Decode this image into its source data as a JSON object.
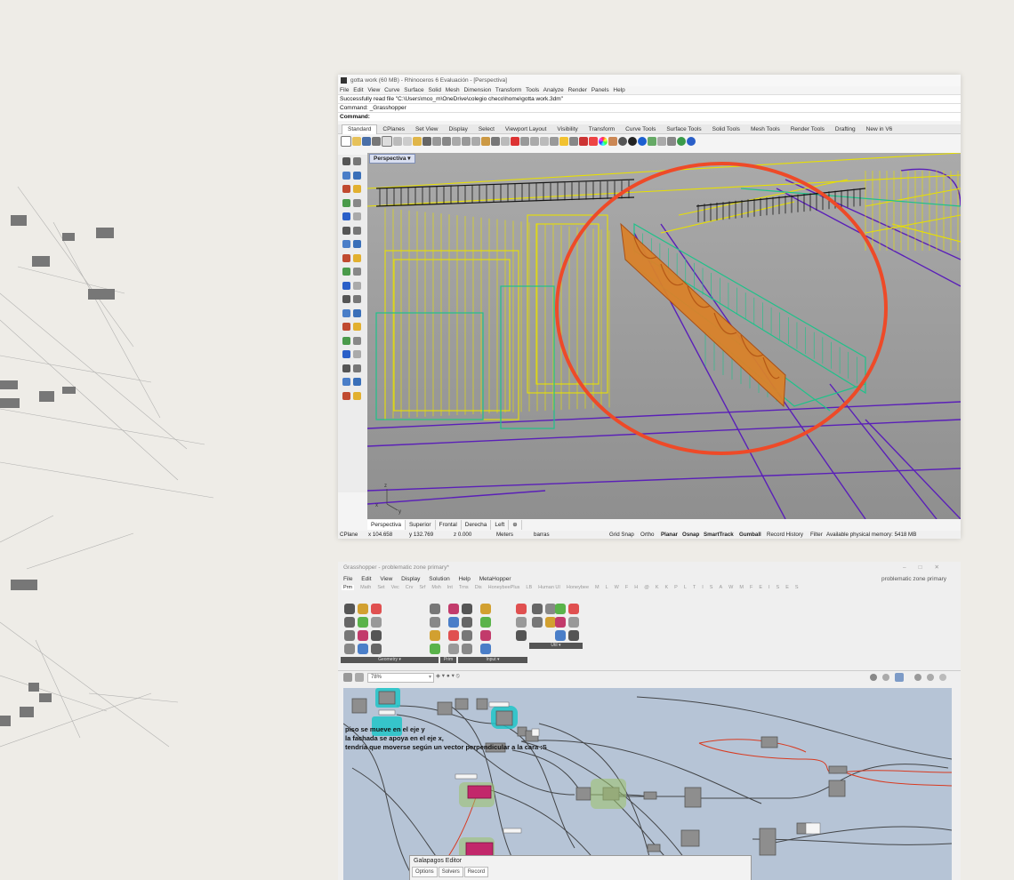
{
  "rhino": {
    "title": "gotta work (60 MB) - Rhinoceros 6 Evaluación - [Perspectiva]",
    "menu": [
      "File",
      "Edit",
      "View",
      "Curve",
      "Surface",
      "Solid",
      "Mesh",
      "Dimension",
      "Transform",
      "Tools",
      "Analyze",
      "Render",
      "Panels",
      "Help"
    ],
    "command_history_line": "Successfully read file \"C:\\Users\\mco_m\\OneDrive\\colegio checo\\home\\gotta work.3dm\"",
    "command_last": "Command: _Grasshopper",
    "command_prompt": "Command:",
    "toolbar_tabs": [
      "Standard",
      "CPlanes",
      "Set View",
      "Display",
      "Select",
      "Viewport Layout",
      "Visibility",
      "Transform",
      "Curve Tools",
      "Surface Tools",
      "Solid Tools",
      "Mesh Tools",
      "Render Tools",
      "Drafting",
      "New in V6"
    ],
    "active_tab": "Standard",
    "viewport_label": "Perspectiva",
    "viewport_tabs": [
      "Perspectiva",
      "Superior",
      "Frontal",
      "Derecha",
      "Left"
    ],
    "status": {
      "cplane": "CPlane",
      "x": "x 104.658",
      "y": "y 132.769",
      "z": "z 0.000",
      "units": "Meters",
      "layer": "barras",
      "toggles": [
        "Grid Snap",
        "Ortho",
        "Planar",
        "Osnap",
        "SmartTrack",
        "Gumball",
        "Record History",
        "Filter"
      ],
      "bold_toggles": [
        "Planar",
        "Osnap",
        "SmartTrack",
        "Gumball"
      ],
      "memory": "Available physical memory: 5418 MB"
    }
  },
  "grasshopper": {
    "title": "Grasshopper - problematic zone primary*",
    "document_name": "problematic zone primary",
    "menu": [
      "File",
      "Edit",
      "View",
      "Display",
      "Solution",
      "Help",
      "MetaHopper"
    ],
    "component_tabs": [
      "Prm",
      "Math",
      "Set",
      "Vec",
      "Crv",
      "Srf",
      "Msh",
      "Int",
      "Trns",
      "Dis",
      "HoneybeePlus",
      "LB",
      "Human UI",
      "Honeybee",
      "M",
      "L",
      "W",
      "F",
      "H",
      "@",
      "K",
      "K",
      "P",
      "L",
      "T",
      "I",
      "S",
      "A",
      "W",
      "M",
      "F",
      "E",
      "I",
      "S",
      "E",
      "S"
    ],
    "active_component_tab": "Prm",
    "ribbon_groups": [
      "Geometry",
      "Prim",
      "Input",
      "Util"
    ],
    "zoom": "78%",
    "canvas_note_lines": [
      "piso se mueve en el eje y",
      "la fachada se apoya en el eje x,",
      "tendría que moverse según un vector perpendicular a la cara :S"
    ]
  },
  "galapagos": {
    "title": "Galapagos Editor",
    "tabs": [
      "Options",
      "Solvers",
      "Record"
    ]
  },
  "colors": {
    "annotation_circle": "#ee4a28",
    "wire_yellow": "#e8e000",
    "wire_purple": "#5a1fb8",
    "wire_green": "#1fc28a",
    "highlight_orange": "#d9822b",
    "gh_canvas": "#b6c4d6",
    "gh_cluster": "#c2286b"
  }
}
